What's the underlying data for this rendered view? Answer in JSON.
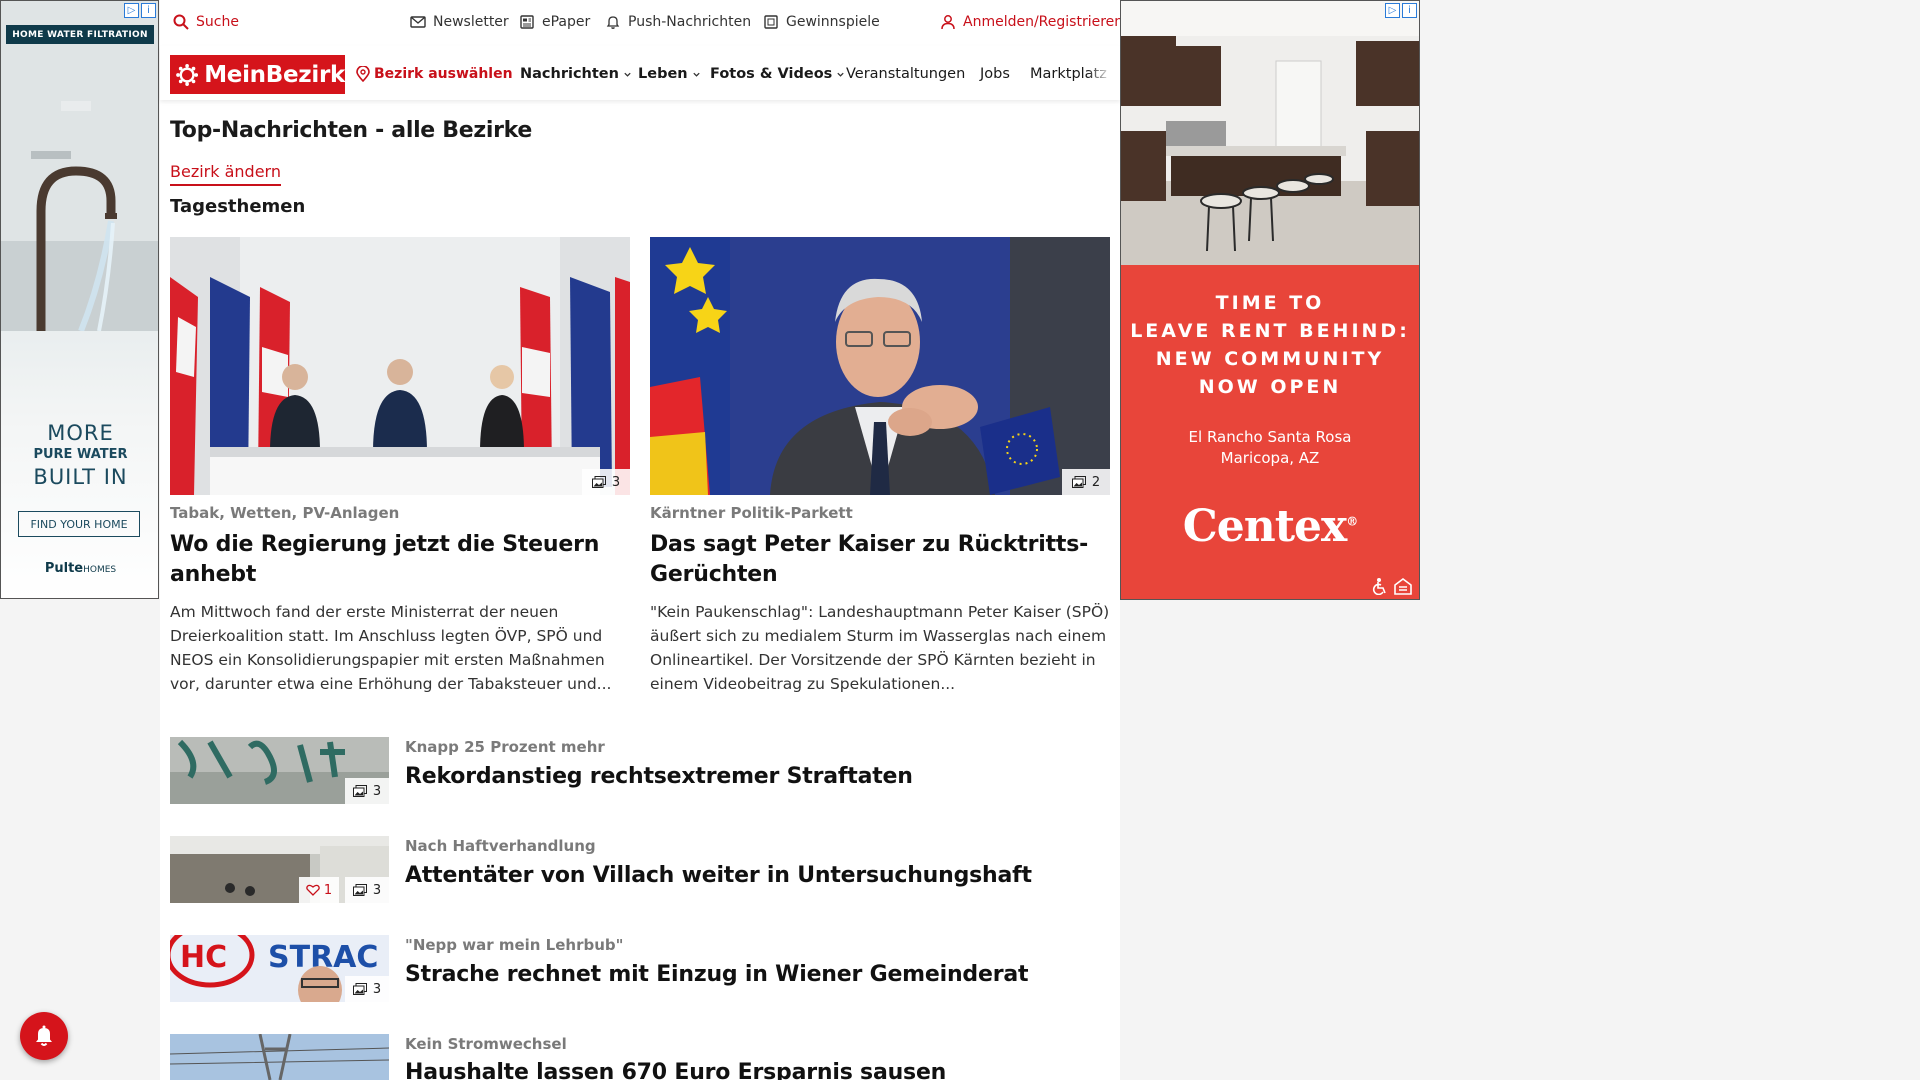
{
  "utility_bar": {
    "search_label": "Suche",
    "newsletter_label": "Newsletter",
    "epaper_label": "ePaper",
    "push_label": "Push-Nachrichten",
    "gewinnspiele_label": "Gewinnspiele",
    "login_label": "Anmelden/Registrieren"
  },
  "nav": {
    "logo_text": "MeinBezirk",
    "district_select_label": "Bezirk auswählen",
    "items": [
      {
        "label": "Nachrichten"
      },
      {
        "label": "Leben"
      },
      {
        "label": "Fotos & Videos"
      },
      {
        "label": "Veranstaltungen"
      },
      {
        "label": "Jobs"
      },
      {
        "label": "Marktplatz"
      }
    ]
  },
  "page": {
    "title": "Top-Nachrichten - alle Bezirke",
    "change_district_label": "Bezirk ändern",
    "section_title": "Tagesthemen"
  },
  "featured": [
    {
      "kicker": "Tabak, Wetten, PV-Anlagen",
      "title": "Wo die Regierung jetzt die Steuern anhebt",
      "excerpt": "Am Mittwoch fand der erste Ministerrat der neuen Dreierkoalition statt. Im Anschluss legten ÖVP, SPÖ und NEOS ein Konsolidierungspapier mit ersten Maßnahmen vor, darunter etwa eine Erhöhung der Tabaksteuer und...",
      "image_count": "3"
    },
    {
      "kicker": "Kärntner Politik-Parkett",
      "title": "Das sagt Peter Kaiser zu Rücktritts-Gerüchten",
      "excerpt": "\"Kein Paukenschlag\": Landeshauptmann Peter Kaiser (SPÖ) äußert sich zu medialem Sturm im Wasserglas nach einem Onlineartikel. Der Vorsitzende der SPÖ Kärnten bezieht in einem Videobeitrag zu Spekulationen...",
      "image_count": "2"
    }
  ],
  "list_articles": [
    {
      "kicker": "Knapp 25 Prozent mehr",
      "title": "Rekordanstieg rechtsextremer Straftaten",
      "image_count": "3"
    },
    {
      "kicker": "Nach Haftverhandlung",
      "title": "Attentäter von Villach weiter in Untersuchungshaft",
      "image_count": "3",
      "likes": "1"
    },
    {
      "kicker": "\"Nepp war mein Lehrbub\"",
      "title": "Strache rechnet mit Einzug in Wiener Gemeinderat",
      "image_count": "3"
    },
    {
      "kicker": "Kein Stromwechsel",
      "title": "Haushalte lassen 670 Euro Ersparnis sausen",
      "image_count": ""
    }
  ],
  "ad_left": {
    "top_label": "HOME WATER FILTRATION",
    "line1": "MORE",
    "line2": "PURE WATER",
    "line3": "BUILT IN",
    "cta": "FIND YOUR HOME",
    "brand": "Pulte",
    "brand_suffix": "HOMES"
  },
  "ad_right": {
    "headline": [
      "TIME TO",
      "LEAVE RENT BEHIND:",
      "NEW COMMUNITY",
      "NOW OPEN"
    ],
    "location_line1": "El Rancho Santa Rosa",
    "location_line2": "Maricopa, AZ",
    "brand": "Centex",
    "brand_mark": "®"
  },
  "colors": {
    "brand_red": "#d5141b",
    "link_red": "#c8101a",
    "ad_red": "#e8453a"
  }
}
